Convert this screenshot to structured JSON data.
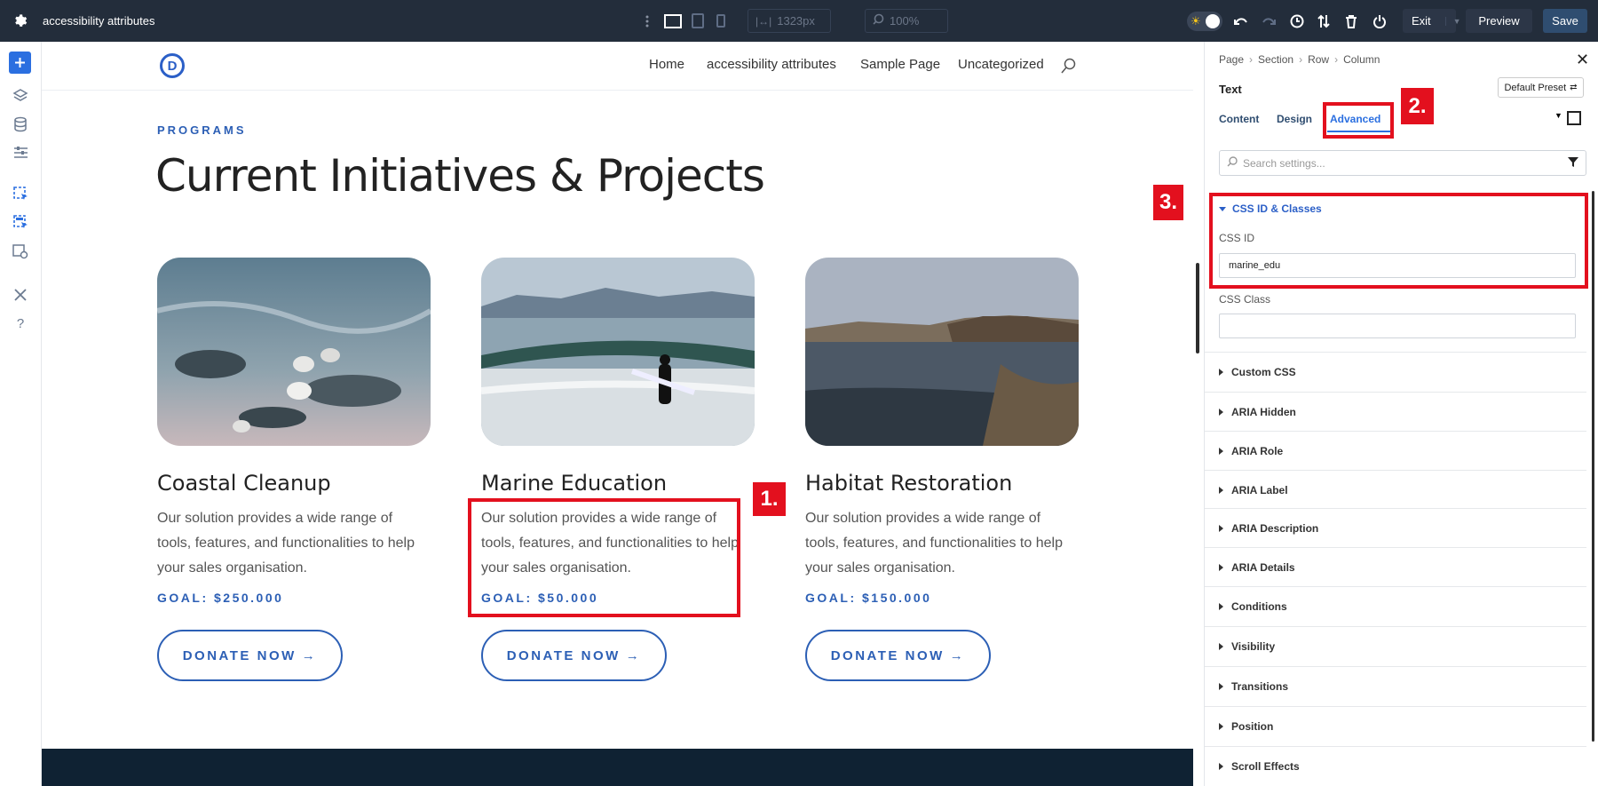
{
  "topbar": {
    "page_title": "accessibility attributes",
    "width_value": "1323px",
    "zoom_value": "100%",
    "exit_label": "Exit",
    "preview_label": "Preview",
    "save_label": "Save"
  },
  "site": {
    "nav": [
      "Home",
      "accessibility attributes",
      "Sample Page",
      "Uncategorized"
    ],
    "logo_letter": "D",
    "eyebrow": "PROGRAMS",
    "headline": "Current Initiatives & Projects",
    "cards": [
      {
        "title": "Coastal Cleanup",
        "desc": "Our solution provides a wide range of tools, features, and functionalities to help your sales organisation.",
        "goal": "GOAL: $250.000",
        "button": "DONATE NOW"
      },
      {
        "title": "Marine Education",
        "desc": "Our solution provides a wide range of tools, features, and functionalities to help your sales organisation.",
        "goal": "GOAL: $50.000",
        "button": "DONATE NOW"
      },
      {
        "title": "Habitat Restoration",
        "desc": "Our solution provides a wide range of tools, features, and functionalities to help your sales organisation.",
        "goal": "GOAL: $150.000",
        "button": "DONATE NOW"
      }
    ]
  },
  "annotations": [
    "1.",
    "2.",
    "3."
  ],
  "panel": {
    "breadcrumb": [
      "Page",
      "Section",
      "Row",
      "Column"
    ],
    "module_title": "Text",
    "preset_label": "Default Preset",
    "tabs": [
      "Content",
      "Design",
      "Advanced"
    ],
    "search_placeholder": "Search settings...",
    "css_section": "CSS ID & Classes",
    "css_id_label": "CSS ID",
    "css_id_value": "marine_edu",
    "css_class_label": "CSS Class",
    "css_class_value": "",
    "sections": [
      "Custom CSS",
      "ARIA Hidden",
      "ARIA Role",
      "ARIA Label",
      "ARIA Description",
      "ARIA Details",
      "Conditions",
      "Visibility",
      "Transitions",
      "Position",
      "Scroll Effects"
    ]
  },
  "colors": {
    "accent": "#2c5fb5",
    "annotation": "#e3101e",
    "topbar": "#232d3b",
    "primary_button": "#2f4d70"
  }
}
